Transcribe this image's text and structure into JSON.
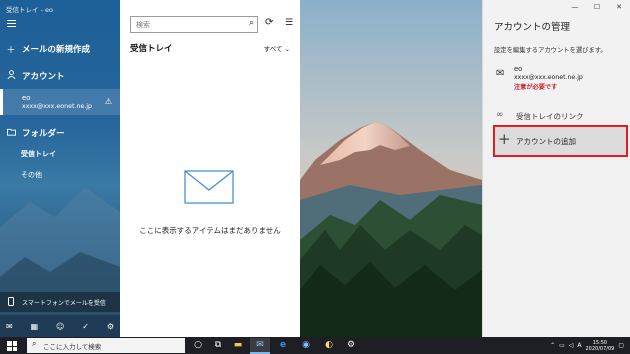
{
  "window": {
    "title": "受信トレイ - eo"
  },
  "sidebar": {
    "new_mail": "メールの新規作成",
    "accounts_label": "アカウント",
    "account": {
      "name": "eo",
      "email": "xxxx@xxx.eonet.ne.jp"
    },
    "folders_label": "フォルダー",
    "folders": [
      {
        "label": "受信トレイ"
      },
      {
        "label": "その他"
      }
    ],
    "phone_promo": "スマートフォンでメールを受信"
  },
  "list": {
    "search_placeholder": "検索",
    "heading": "受信トレイ",
    "filter": "すべて",
    "empty_message": "ここに表示するアイテムはまだありません"
  },
  "manage": {
    "title": "アカウントの管理",
    "subtitle": "設定を編集するアカウントを選びます。",
    "account": {
      "name": "eo",
      "email": "xxxx@xxx.eonet.ne.jp",
      "warning": "注意が必要です"
    },
    "link_inboxes": "受信トレイのリンク",
    "add_account": "アカウントの追加"
  },
  "taskbar": {
    "search_placeholder": "ここに入力して検索",
    "time": "15:50",
    "date": "2020/07/09",
    "ime": "A"
  },
  "colors": {
    "accent": "#1d5f97",
    "warning": "#c4262e",
    "highlight_border": "#e51c23"
  },
  "icons": [
    "hamburger-icon",
    "plus-icon",
    "person-icon",
    "warning-icon",
    "folder-icon",
    "phone-icon",
    "mail-icon",
    "calendar-icon",
    "people-icon",
    "checkmark-icon",
    "gear-icon",
    "search-icon",
    "sync-icon",
    "filter-icon",
    "envelope-icon",
    "link-icon",
    "windows-start-icon"
  ]
}
